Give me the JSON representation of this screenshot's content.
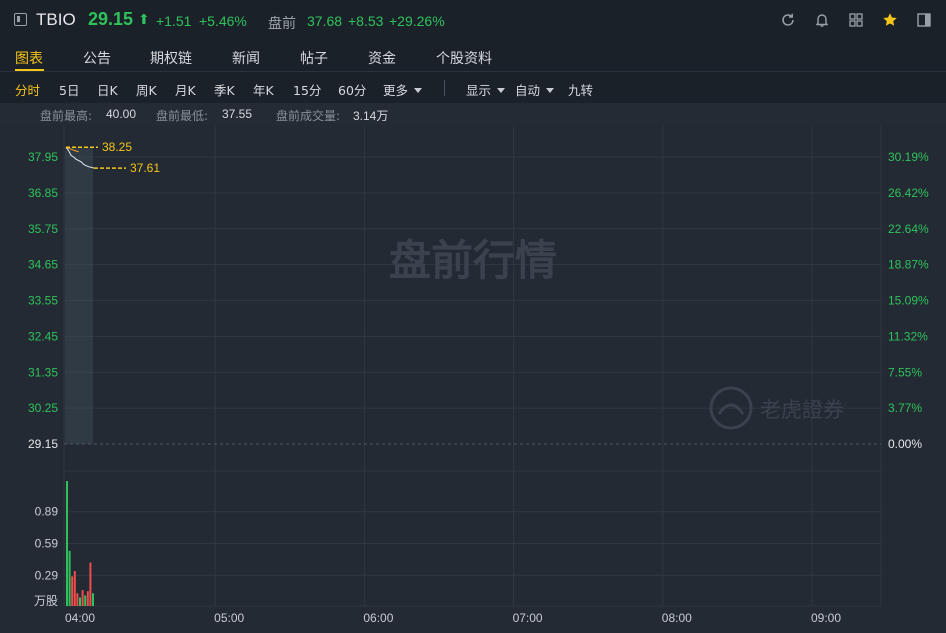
{
  "quote": {
    "ticker": "TBIO",
    "price": "29.15",
    "arrow": "⬆",
    "change": "+1.51",
    "change_pct": "+5.46%",
    "premarket_label": "盘前",
    "premarket_price": "37.68",
    "premarket_change": "+8.53",
    "premarket_change_pct": "+29.26%"
  },
  "colors": {
    "up": "#2fc25b",
    "down": "#f04c4c",
    "accent": "#f5c518",
    "grid": "#2f3741"
  },
  "icons": [
    "refresh-icon",
    "bell-icon",
    "grid-icon",
    "star-icon",
    "sidebar-icon"
  ],
  "main_tabs": [
    {
      "label": "图表",
      "active": true
    },
    {
      "label": "公告"
    },
    {
      "label": "期权链"
    },
    {
      "label": "新闻"
    },
    {
      "label": "帖子"
    },
    {
      "label": "资金"
    },
    {
      "label": "个股资料"
    }
  ],
  "periods": [
    {
      "label": "分时",
      "active": true
    },
    {
      "label": "5日"
    },
    {
      "label": "日K"
    },
    {
      "label": "周K"
    },
    {
      "label": "月K"
    },
    {
      "label": "季K"
    },
    {
      "label": "年K"
    },
    {
      "label": "15分"
    },
    {
      "label": "60分"
    },
    {
      "label": "更多"
    }
  ],
  "display_options": {
    "display": "显示",
    "auto": "自动",
    "nine_turns": "九转"
  },
  "stats": {
    "high_label": "盘前最高:",
    "high": "40.00",
    "low_label": "盘前最低:",
    "low": "37.55",
    "volume_label": "盘前成交量:",
    "volume": "3.14万"
  },
  "watermark": {
    "title": "盘前行情",
    "brand": "老虎證券"
  },
  "chart_data": {
    "type": "line",
    "y_left_ticks": [
      "37.95",
      "36.85",
      "35.75",
      "34.65",
      "33.55",
      "32.45",
      "31.35",
      "30.25",
      "29.15"
    ],
    "y_right_ticks": [
      "30.19%",
      "26.42%",
      "22.64%",
      "18.87%",
      "15.09%",
      "11.32%",
      "7.55%",
      "3.77%",
      "0.00%"
    ],
    "ylim": [
      29.15,
      37.95
    ],
    "x_ticks": [
      "04:00",
      "05:00",
      "06:00",
      "07:00",
      "08:00",
      "09:00"
    ],
    "annotations": [
      {
        "label": "38.25",
        "value": 38.25
      },
      {
        "label": "37.61",
        "value": 37.61
      }
    ],
    "price": [
      38.25,
      38.15,
      38.0,
      37.95,
      37.88,
      37.84,
      37.8,
      37.72,
      37.68,
      37.65,
      37.63,
      37.61
    ],
    "avg": [
      38.25,
      38.22,
      38.19,
      38.16,
      38.13,
      38.11
    ],
    "volume_ticks": [
      "0.89",
      "0.59",
      "0.29"
    ],
    "volume_unit": "万股",
    "volume_max": 1.18,
    "volume": [
      {
        "v": 1.18,
        "dir": "up"
      },
      {
        "v": 0.52,
        "dir": "up"
      },
      {
        "v": 0.28,
        "dir": "down"
      },
      {
        "v": 0.33,
        "dir": "down"
      },
      {
        "v": 0.12,
        "dir": "down"
      },
      {
        "v": 0.08,
        "dir": "up"
      },
      {
        "v": 0.15,
        "dir": "down"
      },
      {
        "v": 0.1,
        "dir": "up"
      },
      {
        "v": 0.14,
        "dir": "down"
      },
      {
        "v": 0.41,
        "dir": "down"
      },
      {
        "v": 0.12,
        "dir": "up"
      }
    ]
  }
}
